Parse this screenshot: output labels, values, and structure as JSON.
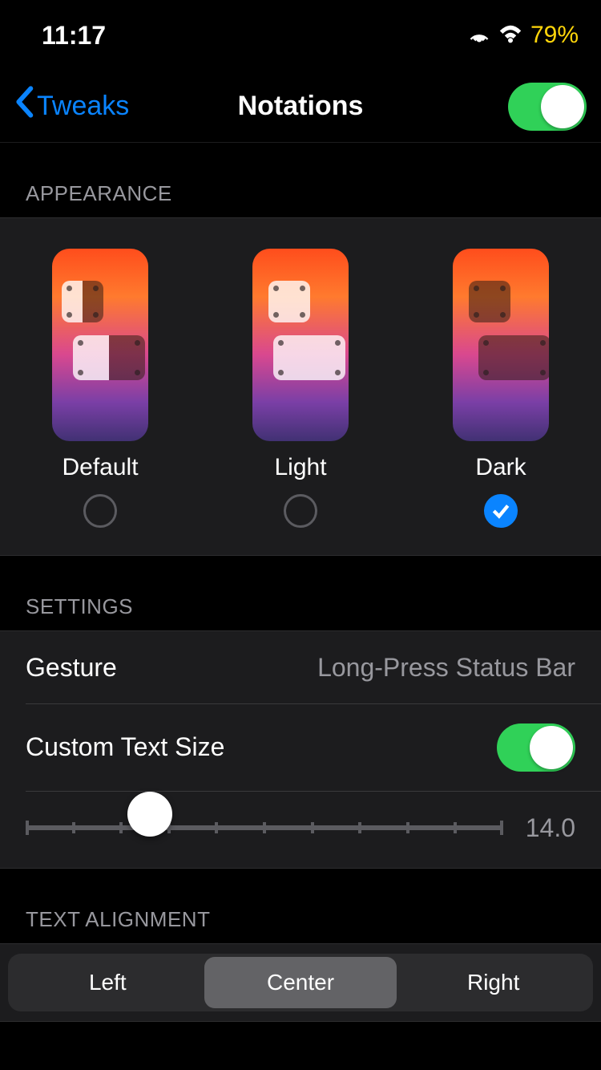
{
  "statusbar": {
    "time": "11:17",
    "battery": "79%"
  },
  "nav": {
    "back": "Tweaks",
    "title": "Notations",
    "master_toggle": true
  },
  "sections": {
    "appearance": {
      "header": "APPEARANCE",
      "options": [
        {
          "label": "Default",
          "selected": false
        },
        {
          "label": "Light",
          "selected": false
        },
        {
          "label": "Dark",
          "selected": true
        }
      ]
    },
    "settings": {
      "header": "SETTINGS",
      "gesture": {
        "label": "Gesture",
        "value": "Long-Press Status Bar"
      },
      "custom_text_size": {
        "label": "Custom Text Size",
        "enabled": true
      },
      "slider": {
        "value": "14.0",
        "position_pct": 26,
        "ticks": 11
      }
    },
    "alignment": {
      "header": "TEXT ALIGNMENT",
      "options": [
        "Left",
        "Center",
        "Right"
      ],
      "selected": "Center"
    }
  }
}
